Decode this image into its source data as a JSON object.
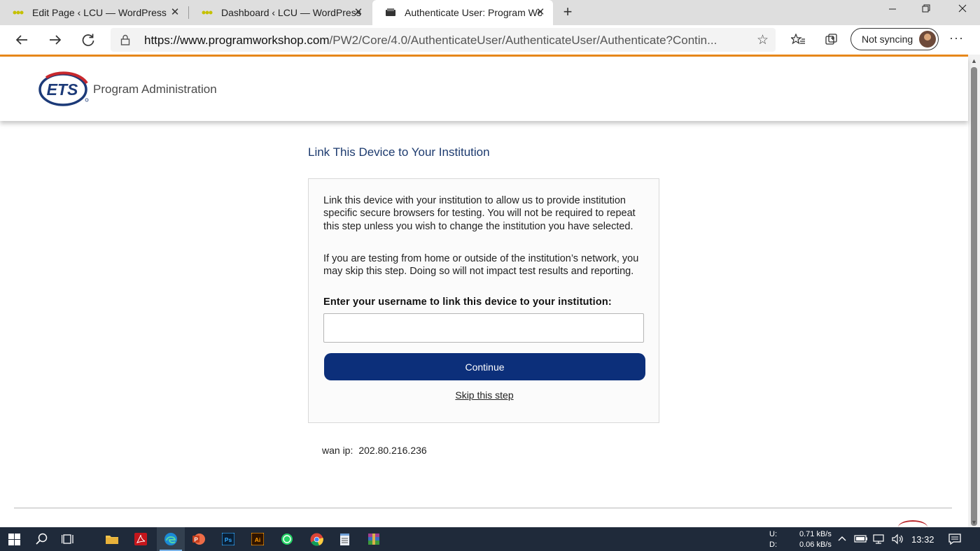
{
  "browser": {
    "tabs": [
      {
        "title": "Edit Page ‹ LCU — WordPress",
        "active": false
      },
      {
        "title": "Dashboard ‹ LCU — WordPress",
        "active": false
      },
      {
        "title": "Authenticate User: Program Wor",
        "active": true
      }
    ],
    "close_glyph": "✕",
    "new_tab_glyph": "+",
    "url_host": "https://www.programworkshop.com",
    "url_path": "/PW2/Core/4.0/AuthenticateUser/AuthenticateUser/Authenticate?Contin...",
    "sync_label": "Not syncing",
    "accent_color": "#e8891b"
  },
  "header": {
    "logo_text": "ETS",
    "brand": "Program Administration"
  },
  "main": {
    "title": "Link This Device to Your Institution",
    "paragraph1": "Link this device with your institution to allow us to provide institution specific secure browsers for testing. You will not be required to repeat this step unless you wish to change the institution you have selected.",
    "paragraph2": "If you are testing from home or outside of the institution’s network, you may skip this step. Doing so will not impact test results and reporting.",
    "username_label": "Enter your username to link this device to your institution:",
    "username_value": "",
    "continue_label": "Continue",
    "skip_label": "Skip this step",
    "wan_label": "wan ip:",
    "wan_value": "202.80.216.236",
    "button_color": "#0c2f7a",
    "title_color": "#1c3a6e"
  },
  "taskbar": {
    "apps": [
      "windows-start",
      "search",
      "task-view",
      "file-explorer",
      "acrobat",
      "edge",
      "powerpoint",
      "photoshop",
      "illustrator",
      "whatsapp",
      "chrome",
      "notepad",
      "winrar"
    ],
    "net_up_label": "U:",
    "net_down_label": "D:",
    "net_up": "0.71 kB/s",
    "net_down": "0.06 kB/s",
    "time": "13:32"
  }
}
